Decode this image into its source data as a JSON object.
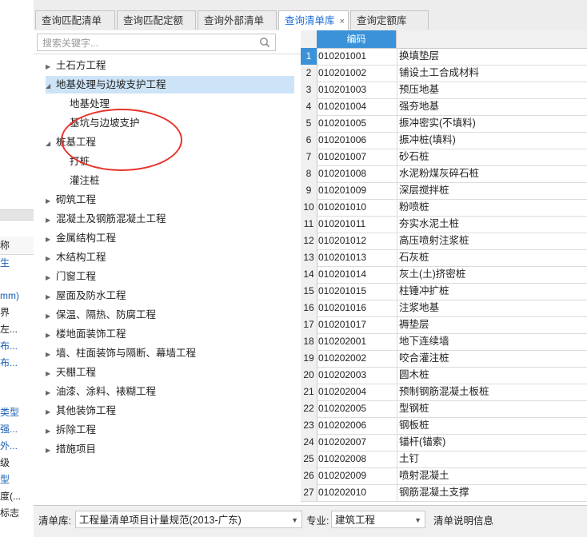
{
  "left_strip": {
    "items": [
      {
        "text": "称",
        "blue": false
      },
      {
        "text": "生",
        "blue": true
      },
      {
        "text": "mm)",
        "blue": true
      },
      {
        "text": "界",
        "blue": false
      },
      {
        "text": "左...",
        "blue": false
      },
      {
        "text": "布...",
        "blue": true
      },
      {
        "text": "布...",
        "blue": true
      },
      {
        "text": "类型",
        "blue": true
      },
      {
        "text": "强...",
        "blue": true
      },
      {
        "text": "外...",
        "blue": true
      },
      {
        "text": "级",
        "blue": false
      },
      {
        "text": "型",
        "blue": true
      },
      {
        "text": "度(...",
        "blue": false
      },
      {
        "text": "标志",
        "blue": false
      }
    ]
  },
  "tabs": [
    {
      "label": "查询匹配清单",
      "active": false,
      "closable": false
    },
    {
      "label": "查询匹配定额",
      "active": false,
      "closable": false
    },
    {
      "label": "查询外部清单",
      "active": false,
      "closable": false
    },
    {
      "label": "查询清单库",
      "active": true,
      "closable": true,
      "close_glyph": "×"
    },
    {
      "label": "查询定额库",
      "active": false,
      "closable": false
    }
  ],
  "search": {
    "placeholder": "搜索关键字...",
    "icon": "search-icon"
  },
  "tree": [
    {
      "label": "土石方工程",
      "level": 0,
      "arrow": "▶",
      "selected": false
    },
    {
      "label": "地基处理与边坡支护工程",
      "level": 0,
      "arrow": "◢",
      "selected": true
    },
    {
      "label": "地基处理",
      "level": 1,
      "arrow": "",
      "selected": false
    },
    {
      "label": "基坑与边坡支护",
      "level": 1,
      "arrow": "",
      "selected": false
    },
    {
      "label": "桩基工程",
      "level": 0,
      "arrow": "◢",
      "selected": false
    },
    {
      "label": "打桩",
      "level": 1,
      "arrow": "",
      "selected": false
    },
    {
      "label": "灌注桩",
      "level": 1,
      "arrow": "",
      "selected": false
    },
    {
      "label": "砌筑工程",
      "level": 0,
      "arrow": "▶",
      "selected": false
    },
    {
      "label": "混凝土及钢筋混凝土工程",
      "level": 0,
      "arrow": "▶",
      "selected": false
    },
    {
      "label": "金属结构工程",
      "level": 0,
      "arrow": "▶",
      "selected": false
    },
    {
      "label": "木结构工程",
      "level": 0,
      "arrow": "▶",
      "selected": false
    },
    {
      "label": "门窗工程",
      "level": 0,
      "arrow": "▶",
      "selected": false
    },
    {
      "label": "屋面及防水工程",
      "level": 0,
      "arrow": "▶",
      "selected": false
    },
    {
      "label": "保温、隔热、防腐工程",
      "level": 0,
      "arrow": "▶",
      "selected": false
    },
    {
      "label": "楼地面装饰工程",
      "level": 0,
      "arrow": "▶",
      "selected": false
    },
    {
      "label": "墙、柱面装饰与隔断、幕墙工程",
      "level": 0,
      "arrow": "▶",
      "selected": false
    },
    {
      "label": "天棚工程",
      "level": 0,
      "arrow": "▶",
      "selected": false
    },
    {
      "label": "油漆、涂料、裱糊工程",
      "level": 0,
      "arrow": "▶",
      "selected": false
    },
    {
      "label": "其他装饰工程",
      "level": 0,
      "arrow": "▶",
      "selected": false
    },
    {
      "label": "拆除工程",
      "level": 0,
      "arrow": "▶",
      "selected": false
    },
    {
      "label": "措施项目",
      "level": 0,
      "arrow": "▶",
      "selected": false
    }
  ],
  "table": {
    "header": {
      "code": "编码"
    },
    "rows": [
      {
        "idx": "1",
        "code": "010201001",
        "name": "换填垫层"
      },
      {
        "idx": "2",
        "code": "010201002",
        "name": "铺设土工合成材料"
      },
      {
        "idx": "3",
        "code": "010201003",
        "name": "预压地基"
      },
      {
        "idx": "4",
        "code": "010201004",
        "name": "强夯地基"
      },
      {
        "idx": "5",
        "code": "010201005",
        "name": "振冲密实(不填料)"
      },
      {
        "idx": "6",
        "code": "010201006",
        "name": "振冲桩(填料)"
      },
      {
        "idx": "7",
        "code": "010201007",
        "name": "砂石桩"
      },
      {
        "idx": "8",
        "code": "010201008",
        "name": "水泥粉煤灰碎石桩"
      },
      {
        "idx": "9",
        "code": "010201009",
        "name": "深层搅拌桩"
      },
      {
        "idx": "10",
        "code": "010201010",
        "name": "粉喷桩"
      },
      {
        "idx": "11",
        "code": "010201011",
        "name": "夯实水泥土桩"
      },
      {
        "idx": "12",
        "code": "010201012",
        "name": "高压喷射注浆桩"
      },
      {
        "idx": "13",
        "code": "010201013",
        "name": "石灰桩"
      },
      {
        "idx": "14",
        "code": "010201014",
        "name": "灰土(土)挤密桩"
      },
      {
        "idx": "15",
        "code": "010201015",
        "name": "柱锤冲扩桩"
      },
      {
        "idx": "16",
        "code": "010201016",
        "name": "注浆地基"
      },
      {
        "idx": "17",
        "code": "010201017",
        "name": "褥垫层"
      },
      {
        "idx": "18",
        "code": "010202001",
        "name": "地下连续墙"
      },
      {
        "idx": "19",
        "code": "010202002",
        "name": "咬合灌注桩"
      },
      {
        "idx": "20",
        "code": "010202003",
        "name": "圆木桩"
      },
      {
        "idx": "21",
        "code": "010202004",
        "name": "预制钢筋混凝土板桩"
      },
      {
        "idx": "22",
        "code": "010202005",
        "name": "型钢桩"
      },
      {
        "idx": "23",
        "code": "010202006",
        "name": "钢板桩"
      },
      {
        "idx": "24",
        "code": "010202007",
        "name": "锚杆(锚索)"
      },
      {
        "idx": "25",
        "code": "010202008",
        "name": "土钉"
      },
      {
        "idx": "26",
        "code": "010202009",
        "name": "喷射混凝土"
      },
      {
        "idx": "27",
        "code": "010202010",
        "name": "钢筋混凝土支撑"
      }
    ]
  },
  "bottom": {
    "library_label": "清单库:",
    "library_value": "工程量清单项目计量规范(2013-广东)",
    "major_label": "专业:",
    "major_value": "建筑工程",
    "info_label": "清单说明信息",
    "dropdown_glyph": "▼"
  },
  "colors": {
    "accent": "#3c92d8",
    "selected_row": "#cde3f7",
    "annotation_circle": "#e8342b",
    "link_blue": "#1a5fb4"
  }
}
